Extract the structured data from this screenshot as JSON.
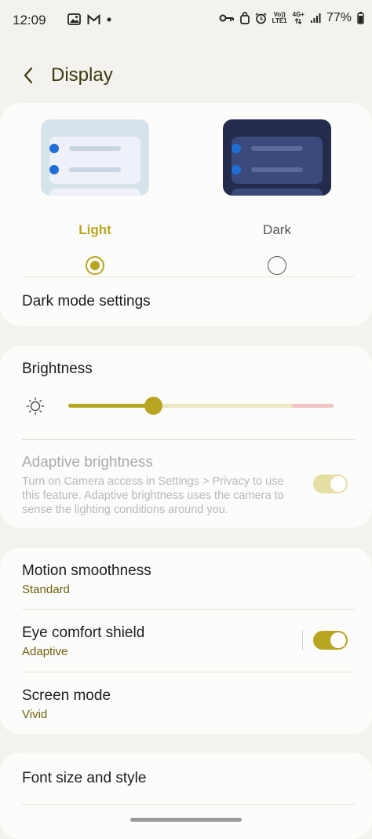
{
  "status_bar": {
    "time": "12:09",
    "notification_icons": [
      "gallery-icon",
      "gmail-icon",
      "dot-icon"
    ],
    "network_top": "Vo))",
    "network_bottom": "LTE1",
    "network_type": "4G+",
    "battery": "77%"
  },
  "header": {
    "title": "Display"
  },
  "theme": {
    "light_label": "Light",
    "dark_label": "Dark",
    "selected": "Light"
  },
  "dark_mode_settings": {
    "label": "Dark mode settings"
  },
  "brightness": {
    "label": "Brightness",
    "level": 0.32
  },
  "adaptive_brightness": {
    "label": "Adaptive brightness",
    "description": "Turn on Camera access in Settings > Privacy to use this feature. Adaptive brightness uses the camera to sense the lighting conditions around you.",
    "enabled": false
  },
  "motion_smoothness": {
    "label": "Motion smoothness",
    "value": "Standard"
  },
  "eye_comfort_shield": {
    "label": "Eye comfort shield",
    "value": "Adaptive",
    "on": true
  },
  "screen_mode": {
    "label": "Screen mode",
    "value": "Vivid"
  },
  "font_size_style": {
    "label": "Font size and style"
  },
  "colors": {
    "accent": "#b7a522",
    "accent_dark": "#6e6211",
    "background": "#f3f2ee",
    "card": "#fcfcfa"
  }
}
